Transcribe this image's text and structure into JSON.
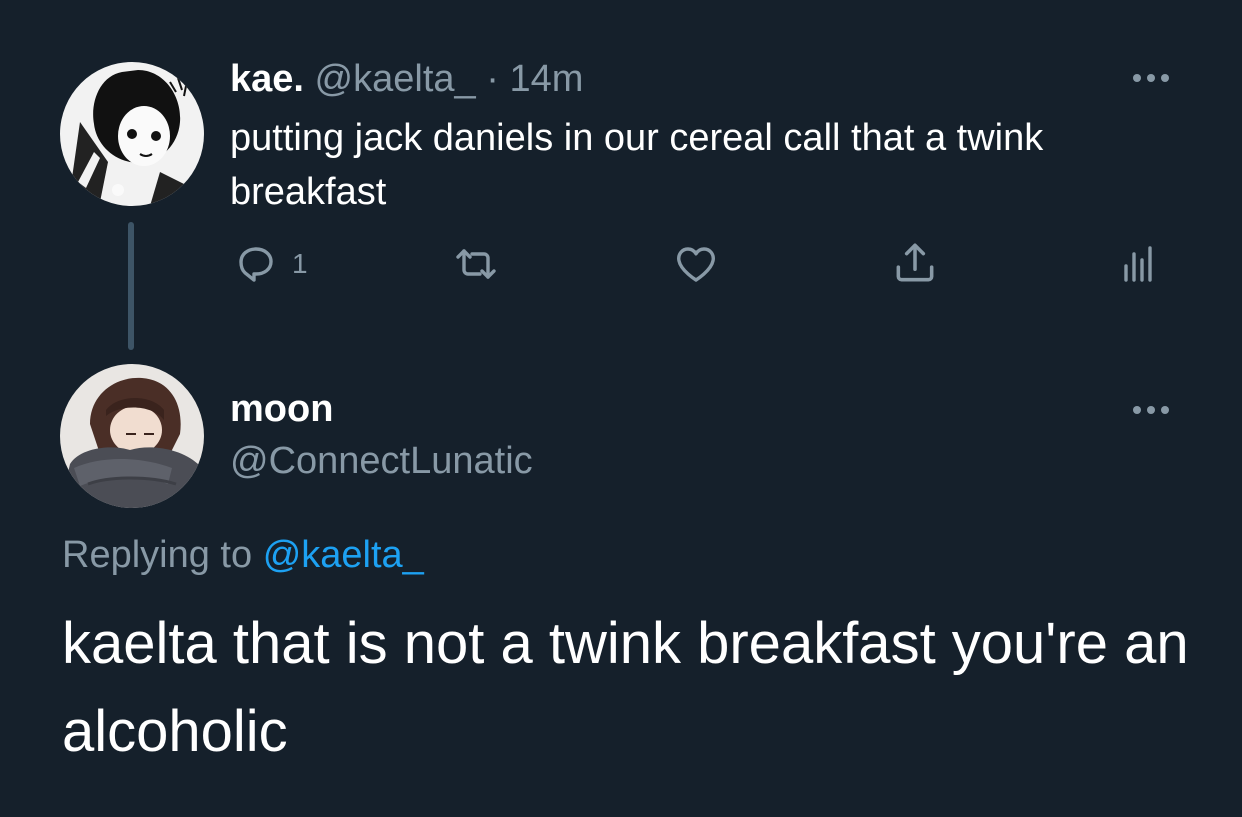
{
  "original_tweet": {
    "display_name": "kae.",
    "handle": "@kaelta_",
    "separator": "·",
    "time": "14m",
    "text": "putting jack daniels in our cereal call that a twink breakfast",
    "reply_count": "1",
    "icons": [
      "reply-icon",
      "retweet-icon",
      "like-icon",
      "share-icon",
      "analytics-icon",
      "more-icon"
    ]
  },
  "reply_tweet": {
    "display_name": "moon",
    "handle": "@ConnectLunatic",
    "replying_to_label": "Replying to",
    "replying_to_handle": "@kaelta_",
    "text": "kaelta that is not a twink breakfast you're an alcoholic",
    "icons": [
      "more-icon"
    ]
  },
  "colors": {
    "background": "#15202b",
    "text_primary": "#ffffff",
    "text_secondary": "#8899a6",
    "accent": "#1da1f2",
    "thread_line": "#3d5466"
  }
}
